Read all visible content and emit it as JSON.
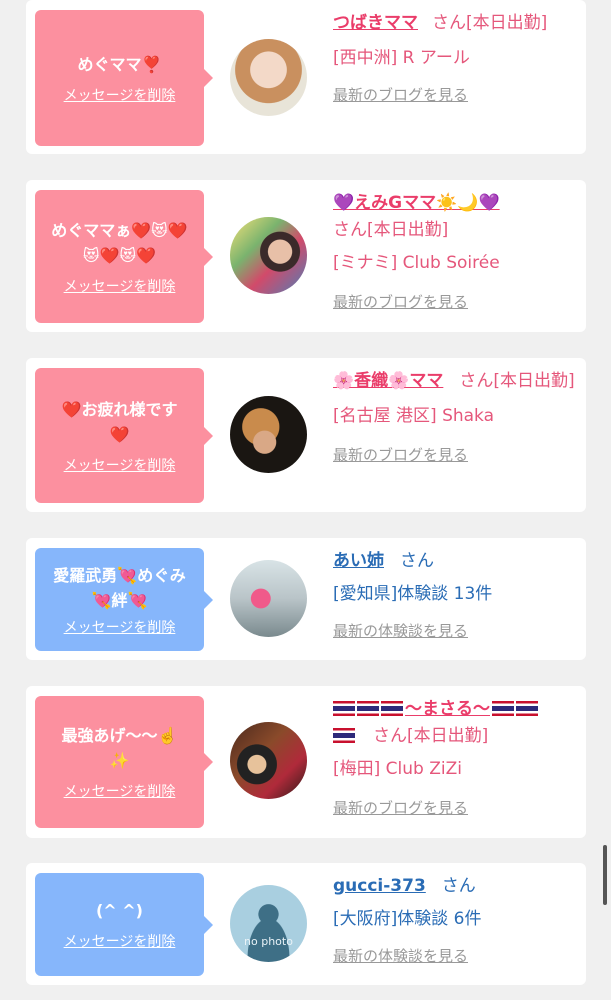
{
  "cards": [
    {
      "message": "めぐママ❣️",
      "delete_label": "メッセージを削除",
      "name": "つばきママ",
      "suffix": "さん[本日出勤]",
      "location": "[西中洲] R アール",
      "link": "最新のブログを見る",
      "theme": "pink"
    },
    {
      "message": "めぐママぁ❤️😻❤️😻❤️😻❤️",
      "delete_label": "メッセージを削除",
      "name": "💜えみGママ☀️🌙💜",
      "suffix": "さん[本日出勤]",
      "location": "[ミナミ] Club Soirée",
      "link": "最新のブログを見る",
      "theme": "pink"
    },
    {
      "message": "❤️お疲れ様です❤️",
      "delete_label": "メッセージを削除",
      "name": "🌸香織🌸ママ",
      "suffix": "さん[本日出勤]",
      "location": "[名古屋 港区] Shaka",
      "link": "最新のブログを見る",
      "theme": "pink"
    },
    {
      "message": "愛羅武勇💘めぐみ💘絆💘",
      "delete_label": "メッセージを削除",
      "name": "あい姉",
      "suffix": "さん",
      "location": "[愛知県]体験談 13件",
      "link": "最新の体験談を見る",
      "theme": "blue"
    },
    {
      "message": "最強あげ〜〜☝️✨",
      "delete_label": "メッセージを削除",
      "name": "〜まさる〜",
      "suffix": "さん[本日出勤]",
      "location": "[梅田] Club ZiZi",
      "link": "最新のブログを見る",
      "theme": "pink"
    },
    {
      "message": "(^ ^)",
      "delete_label": "メッセージを削除",
      "name": "gucci-373",
      "suffix": "さん",
      "location": "[大阪府]体験談 6件",
      "link": "最新の体験談を見る",
      "avatar_text": "no photo",
      "theme": "blue"
    }
  ]
}
